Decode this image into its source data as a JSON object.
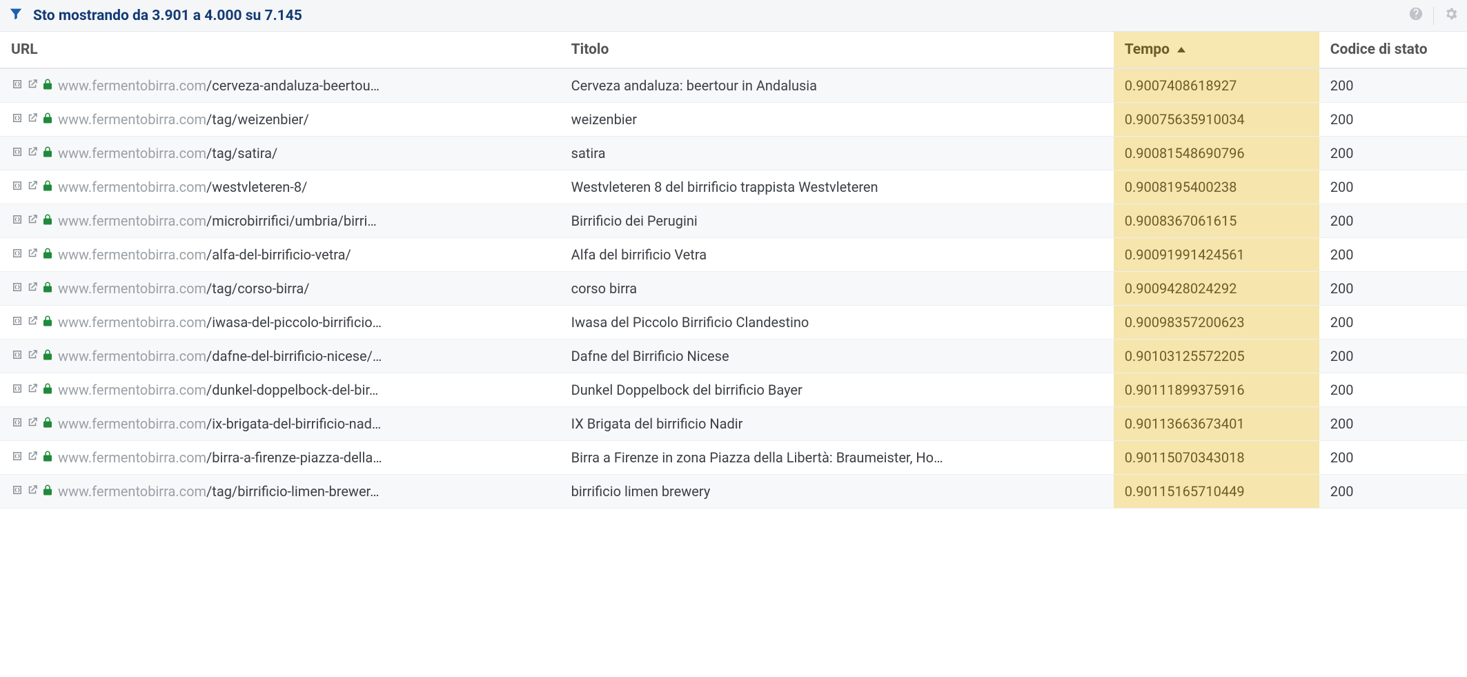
{
  "toolbar": {
    "title": "Sto mostrando da 3.901 a 4.000 su 7.145"
  },
  "columns": {
    "url": "URL",
    "title": "Titolo",
    "time": "Tempo",
    "status": "Codice di stato"
  },
  "sorted_column": "time",
  "sort_direction": "asc",
  "rows": [
    {
      "domain": "www.fermentobirra.com",
      "path": "/cerveza-andaluza-beertou…",
      "title": "Cerveza andaluza: beertour in Andalusia",
      "time": "0.9007408618927",
      "status": "200"
    },
    {
      "domain": "www.fermentobirra.com",
      "path": "/tag/weizenbier/",
      "title": "weizenbier",
      "time": "0.90075635910034",
      "status": "200"
    },
    {
      "domain": "www.fermentobirra.com",
      "path": "/tag/satira/",
      "title": "satira",
      "time": "0.90081548690796",
      "status": "200"
    },
    {
      "domain": "www.fermentobirra.com",
      "path": "/westvleteren-8/",
      "title": "Westvleteren 8 del birrificio trappista Westvleteren",
      "time": "0.9008195400238",
      "status": "200"
    },
    {
      "domain": "www.fermentobirra.com",
      "path": "/microbirrifici/umbria/birri…",
      "title": "Birrificio dei Perugini",
      "time": "0.9008367061615",
      "status": "200"
    },
    {
      "domain": "www.fermentobirra.com",
      "path": "/alfa-del-birrificio-vetra/",
      "title": "Alfa del birrificio Vetra",
      "time": "0.90091991424561",
      "status": "200"
    },
    {
      "domain": "www.fermentobirra.com",
      "path": "/tag/corso-birra/",
      "title": "corso birra",
      "time": "0.9009428024292",
      "status": "200"
    },
    {
      "domain": "www.fermentobirra.com",
      "path": "/iwasa-del-piccolo-birrificio…",
      "title": "Iwasa del Piccolo Birrificio Clandestino",
      "time": "0.90098357200623",
      "status": "200"
    },
    {
      "domain": "www.fermentobirra.com",
      "path": "/dafne-del-birrificio-nicese/…",
      "title": "Dafne del Birrificio Nicese",
      "time": "0.90103125572205",
      "status": "200"
    },
    {
      "domain": "www.fermentobirra.com",
      "path": "/dunkel-doppelbock-del-bir…",
      "title": "Dunkel Doppelbock del birrificio Bayer",
      "time": "0.90111899375916",
      "status": "200"
    },
    {
      "domain": "www.fermentobirra.com",
      "path": "/ix-brigata-del-birrificio-nad…",
      "title": "IX Brigata del birrificio Nadir",
      "time": "0.90113663673401",
      "status": "200"
    },
    {
      "domain": "www.fermentobirra.com",
      "path": "/birra-a-firenze-piazza-della…",
      "title": "Birra a Firenze in zona Piazza della Libertà: Braumeister, Ho…",
      "time": "0.90115070343018",
      "status": "200"
    },
    {
      "domain": "www.fermentobirra.com",
      "path": "/tag/birrificio-limen-brewer…",
      "title": "birrificio limen brewery",
      "time": "0.90115165710449",
      "status": "200"
    }
  ]
}
